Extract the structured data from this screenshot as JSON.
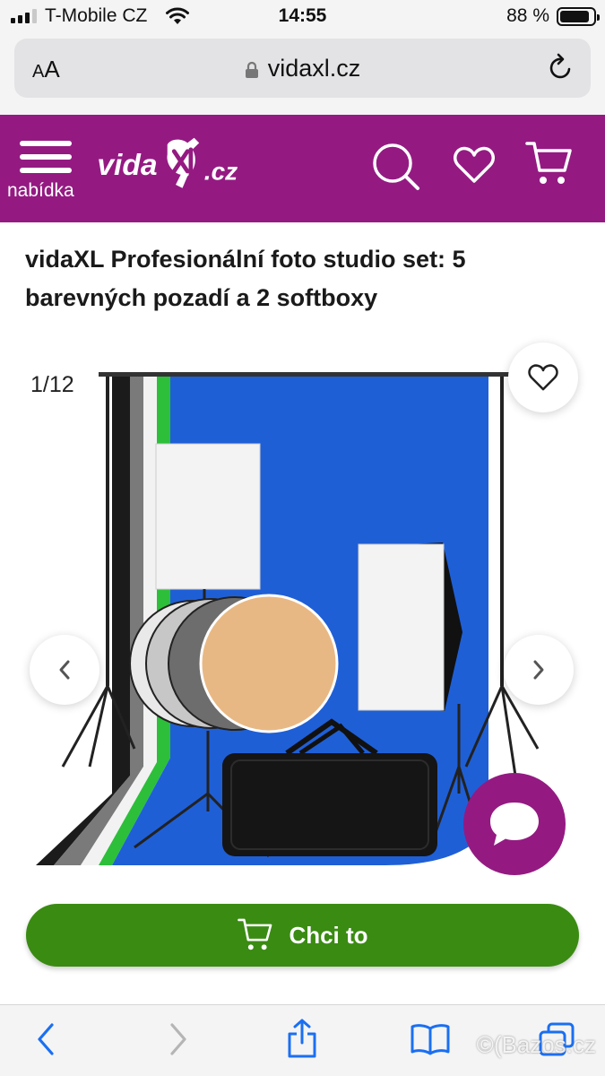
{
  "status_bar": {
    "carrier": "T-Mobile CZ",
    "time": "14:55",
    "battery_percent_label": "88 %",
    "battery_level": 0.88,
    "signal_bars_active": 3,
    "signal_bars_total": 4
  },
  "browser": {
    "text_size_label_small": "A",
    "text_size_label_large": "A",
    "url": "vidaxl.cz"
  },
  "header": {
    "menu_label": "nabídka",
    "logo_text": "vidaXL.cz",
    "brand_color": "#941a82"
  },
  "product": {
    "title": "vidaXL Profesionální foto studio set: 5 barevných pozadí a 2 softboxy",
    "image_counter": "1/12",
    "cta_label": "Chci to",
    "cta_color": "#3a8b12"
  },
  "watermark": "Bazos.cz",
  "icons": [
    "menu-icon",
    "search-icon",
    "heart-icon",
    "cart-icon",
    "chat-icon",
    "chevron-left-icon",
    "chevron-right-icon",
    "share-icon",
    "bookmarks-icon",
    "tabs-icon",
    "lock-icon",
    "reload-icon",
    "wifi-icon"
  ]
}
